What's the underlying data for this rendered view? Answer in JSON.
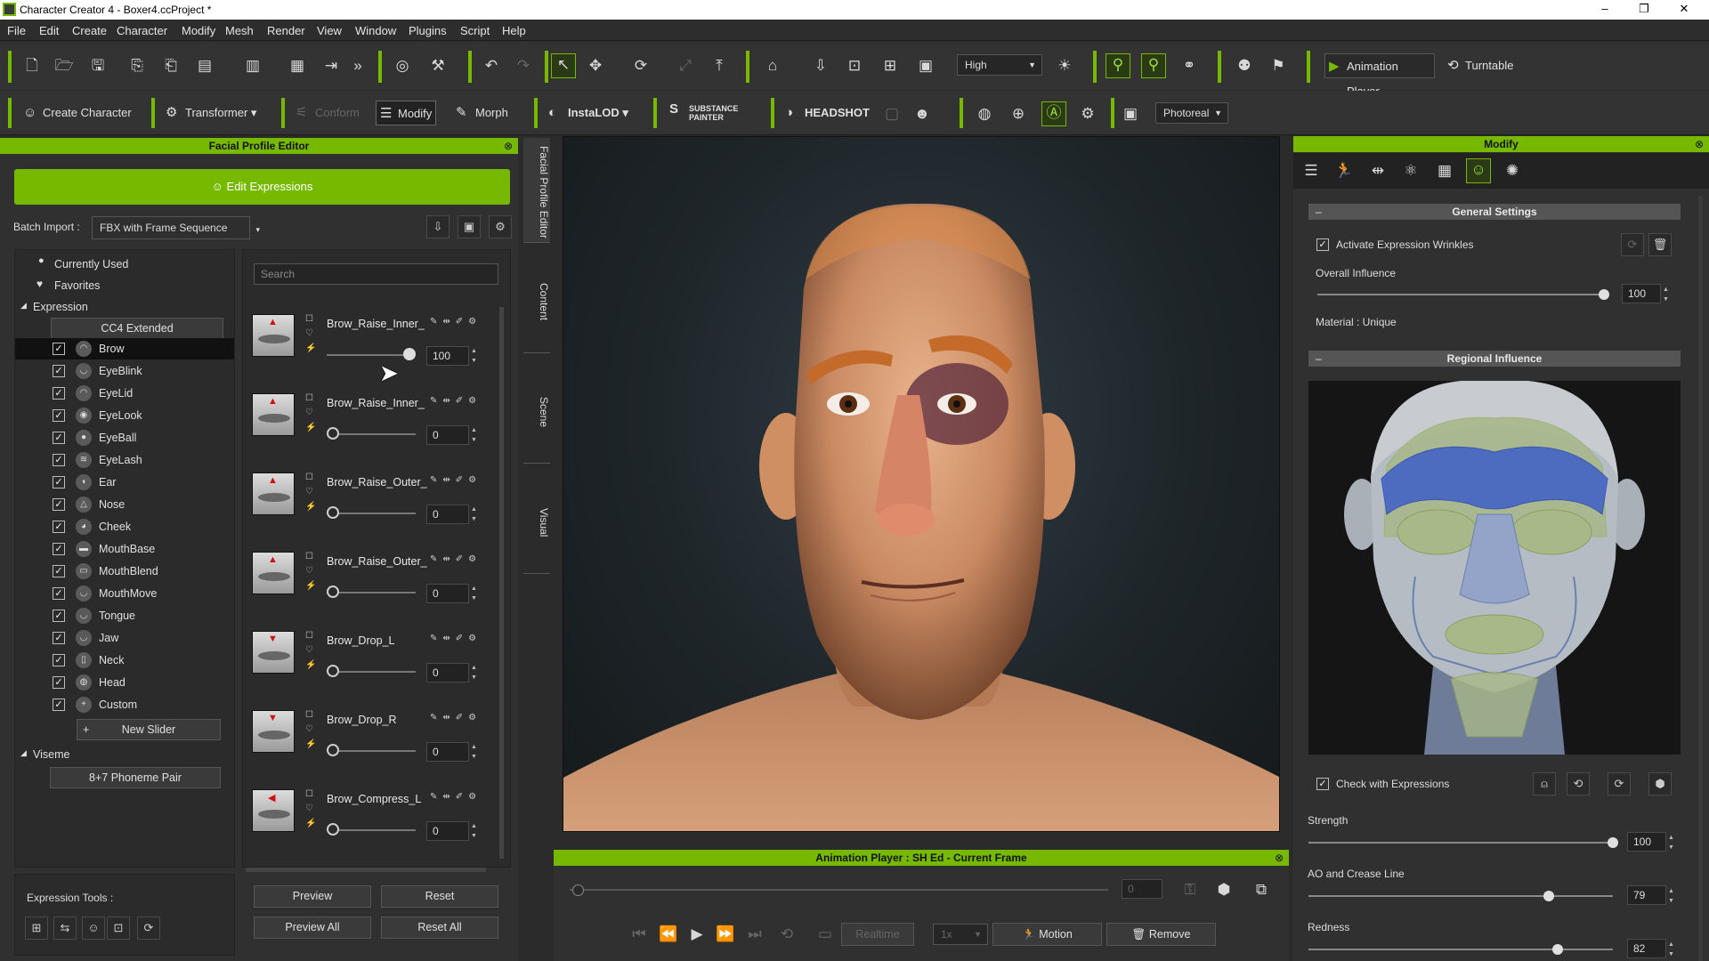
{
  "window": {
    "title": "Character Creator 4 - Boxer4.ccProject *",
    "controls": [
      "–",
      "❐",
      "✕"
    ]
  },
  "menu": [
    "File",
    "Edit",
    "Create",
    "Character",
    "Modify",
    "Mesh",
    "Render",
    "View",
    "Window",
    "Plugins",
    "Script",
    "Help"
  ],
  "toolbar1": {
    "quality": "High",
    "animation_player": "Animation Player",
    "turntable": "Turntable"
  },
  "toolbar2": {
    "create_character": "Create Character",
    "transformer": "Transformer",
    "conform": "Conform",
    "modify": "Modify",
    "morph": "Morph",
    "instalod": "InstaLOD",
    "substance": "SUBSTANCE PAINTER",
    "headshot": "HEADSHOT",
    "render_mode": "Photoreal"
  },
  "left_panel": {
    "title": "Facial Profile Editor",
    "edit_expressions": "Edit Expressions",
    "batch_import_label": "Batch Import :",
    "batch_import_value": "FBX with Frame Sequence",
    "search_placeholder": "Search",
    "tree": {
      "currently_used": "Currently Used",
      "favorites": "Favorites",
      "expression": "Expression",
      "cc4_extended": "CC4 Extended",
      "items": [
        "Brow",
        "EyeBlink",
        "EyeLid",
        "EyeLook",
        "EyeBall",
        "EyeLash",
        "Ear",
        "Nose",
        "Cheek",
        "MouthBase",
        "MouthBlend",
        "MouthMove",
        "Tongue",
        "Jaw",
        "Neck",
        "Head",
        "Custom"
      ],
      "new_slider": "New Slider",
      "viseme": "Viseme",
      "phoneme_pair": "8+7 Phoneme Pair"
    },
    "sliders": [
      {
        "name": "Brow_Raise_Inner_",
        "value": "100",
        "arrow": "▲"
      },
      {
        "name": "Brow_Raise_Inner_",
        "value": "0",
        "arrow": "▲"
      },
      {
        "name": "Brow_Raise_Outer_",
        "value": "0",
        "arrow": "▲"
      },
      {
        "name": "Brow_Raise_Outer_",
        "value": "0",
        "arrow": "▲"
      },
      {
        "name": "Brow_Drop_L",
        "value": "0",
        "arrow": "▼"
      },
      {
        "name": "Brow_Drop_R",
        "value": "0",
        "arrow": "▼"
      },
      {
        "name": "Brow_Compress_L",
        "value": "0",
        "arrow": "◀"
      }
    ],
    "buttons": {
      "preview": "Preview",
      "reset": "Reset",
      "preview_all": "Preview All",
      "reset_all": "Reset All"
    },
    "expression_tools": "Expression Tools :"
  },
  "side_tabs": [
    "Facial Profile Editor",
    "Content",
    "Scene",
    "Visual"
  ],
  "animation_player": {
    "title": "Animation Player : SH Ed - Current Frame",
    "frame": "0",
    "realtime": "Realtime",
    "speed": "1x",
    "motion": "Motion",
    "remove": "Remove"
  },
  "right_panel": {
    "title": "Modify",
    "general_settings": "General Settings",
    "activate_wrinkles": "Activate Expression Wrinkles",
    "overall_influence_label": "Overall Influence",
    "overall_influence": "100",
    "material": "Material : Unique",
    "regional_influence": "Regional Influence",
    "check_with_expressions": "Check with Expressions",
    "strength_label": "Strength",
    "strength": "100",
    "ao_label": "AO and Crease Line",
    "ao": "79",
    "redness_label": "Redness",
    "redness": "82"
  },
  "colors": {
    "accent": "#76b900",
    "panel": "#303030",
    "selected_row": "#111111"
  }
}
